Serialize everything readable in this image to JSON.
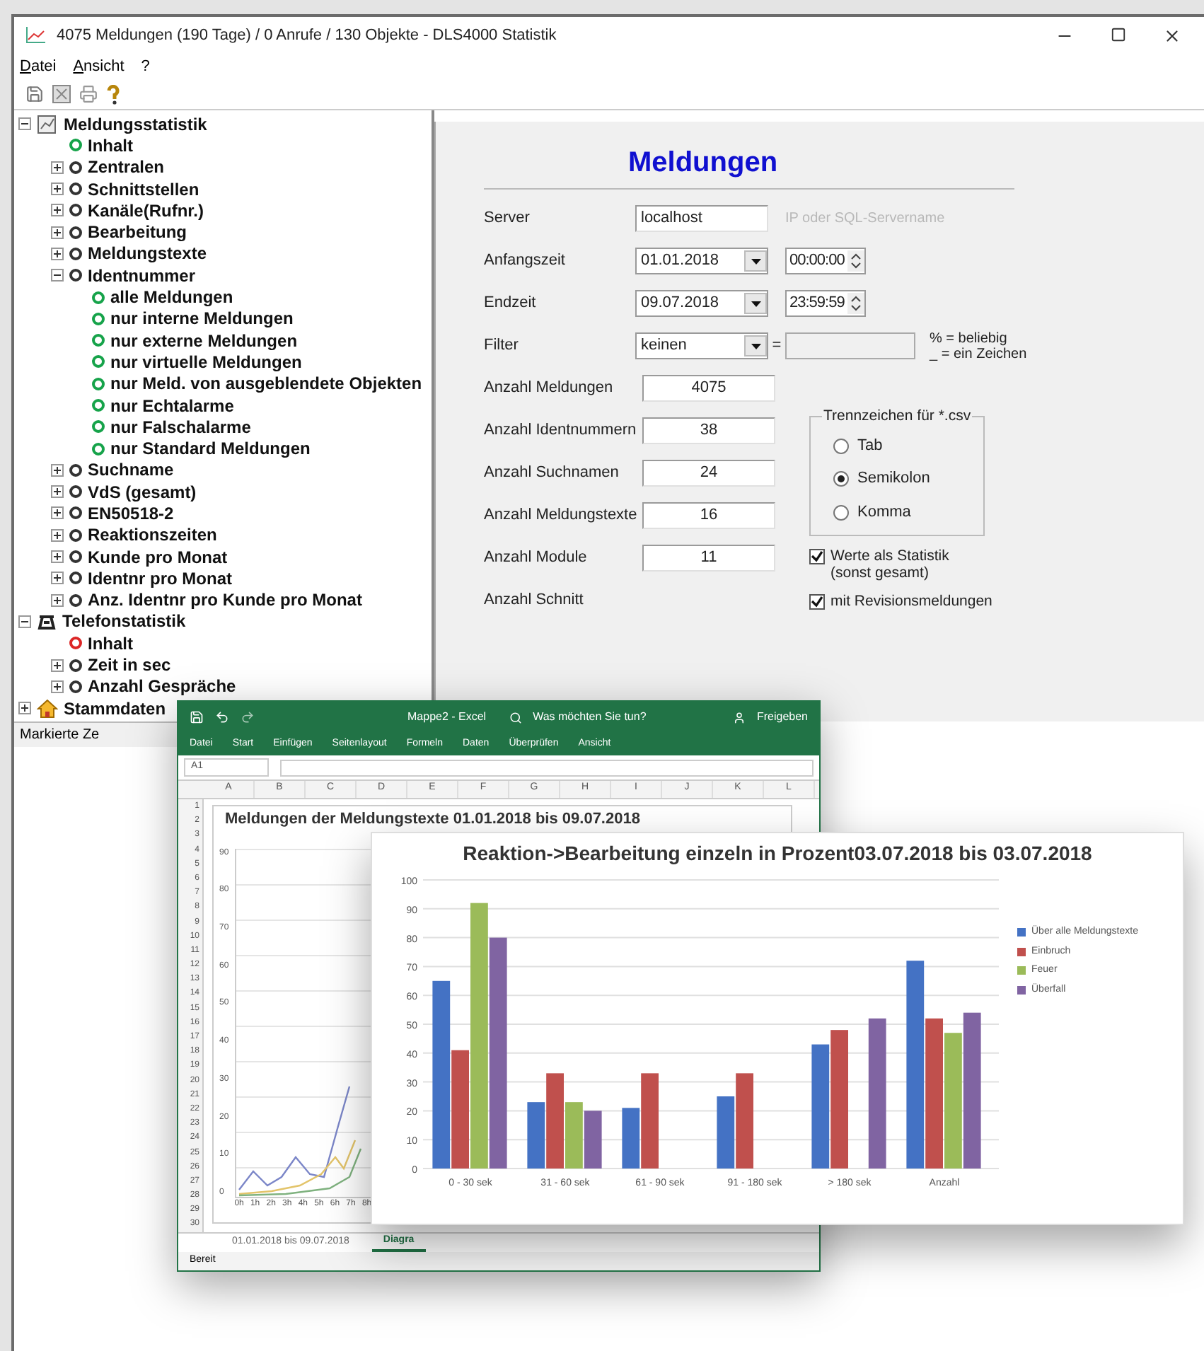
{
  "window": {
    "title": "4075 Meldungen (190 Tage) / 0 Anrufe / 130 Objekte - DLS4000 Statistik"
  },
  "menu": [
    "Datei",
    "Ansicht",
    "?"
  ],
  "tree": [
    {
      "label": "Meldungsstatistik",
      "kind": "report",
      "expanded": true,
      "children": [
        {
          "label": "Inhalt",
          "kind": "leaf",
          "color": "#16a34a"
        },
        {
          "label": "Zentralen",
          "kind": "node",
          "expanded": false,
          "color": "#333333"
        },
        {
          "label": "Schnittstellen",
          "kind": "node",
          "expanded": false,
          "color": "#333333"
        },
        {
          "label": "Kanäle(Rufnr.)",
          "kind": "node",
          "expanded": false,
          "color": "#333333"
        },
        {
          "label": "Bearbeitung",
          "kind": "node",
          "expanded": false,
          "color": "#333333"
        },
        {
          "label": "Meldungstexte",
          "kind": "node",
          "expanded": false,
          "color": "#333333"
        },
        {
          "label": "Identnummer",
          "kind": "node",
          "expanded": true,
          "color": "#333333",
          "children": [
            {
              "label": "alle Meldungen",
              "kind": "leaf",
              "color": "#16a34a"
            },
            {
              "label": "nur interne Meldungen",
              "kind": "leaf",
              "color": "#16a34a"
            },
            {
              "label": "nur externe Meldungen",
              "kind": "leaf",
              "color": "#16a34a"
            },
            {
              "label": "nur virtuelle Meldungen",
              "kind": "leaf",
              "color": "#16a34a"
            },
            {
              "label": "nur Meld. von ausgeblendete Objekten",
              "kind": "leaf",
              "color": "#16a34a"
            },
            {
              "label": "nur Echtalarme",
              "kind": "leaf",
              "color": "#16a34a"
            },
            {
              "label": "nur Falschalarme",
              "kind": "leaf",
              "color": "#16a34a"
            },
            {
              "label": "nur Standard Meldungen",
              "kind": "leaf",
              "color": "#16a34a"
            }
          ]
        },
        {
          "label": "Suchname",
          "kind": "node",
          "expanded": false,
          "color": "#333333"
        },
        {
          "label": "VdS (gesamt)",
          "kind": "node",
          "expanded": false,
          "color": "#333333"
        },
        {
          "label": "EN50518-2",
          "kind": "node",
          "expanded": false,
          "color": "#333333"
        },
        {
          "label": "Reaktionszeiten",
          "kind": "node",
          "expanded": false,
          "color": "#333333"
        },
        {
          "label": "Kunde pro Monat",
          "kind": "node",
          "expanded": false,
          "color": "#333333"
        },
        {
          "label": "Identnr pro Monat",
          "kind": "node",
          "expanded": false,
          "color": "#333333"
        },
        {
          "label": "Anz. Identnr pro Kunde pro Monat",
          "kind": "node",
          "expanded": false,
          "color": "#333333"
        }
      ]
    },
    {
      "label": "Telefonstatistik",
      "kind": "phone",
      "expanded": true,
      "children": [
        {
          "label": "Inhalt",
          "kind": "leaf",
          "color": "#dc2626"
        },
        {
          "label": "Zeit in sec",
          "kind": "node",
          "expanded": false,
          "color": "#333333"
        },
        {
          "label": "Anzahl Gespräche",
          "kind": "node",
          "expanded": false,
          "color": "#333333"
        }
      ]
    },
    {
      "label": "Stammdaten",
      "kind": "house",
      "expanded": false
    }
  ],
  "form": {
    "heading": "Meldungen",
    "server": {
      "label": "Server",
      "value": "localhost",
      "hint": "IP oder SQL-Servername"
    },
    "start": {
      "label": "Anfangszeit",
      "date": "01.01.2018",
      "time": "00:00:00"
    },
    "end": {
      "label": "Endzeit",
      "date": "09.07.2018",
      "time": "23:59:59"
    },
    "filter": {
      "label": "Filter",
      "value": "keinen",
      "equals": "=",
      "hint_lines": [
        "% = beliebig",
        "_ = ein Zeichen"
      ]
    },
    "counts": [
      {
        "label": "Anzahl Meldungen",
        "value": "4075"
      },
      {
        "label": "Anzahl Identnummern",
        "value": "38"
      },
      {
        "label": "Anzahl Suchnamen",
        "value": "24"
      },
      {
        "label": "Anzahl Meldungstexte",
        "value": "16"
      },
      {
        "label": "Anzahl Module",
        "value": "11"
      },
      {
        "label": "Anzahl Schnitt"
      }
    ],
    "separator": {
      "title": "Trennzeichen für *.csv",
      "options": [
        {
          "label": "Tab",
          "selected": false
        },
        {
          "label": "Semikolon",
          "selected": true
        },
        {
          "label": "Komma",
          "selected": false
        }
      ]
    },
    "checks": [
      {
        "label": "Werte als Statistik\n(sonst gesamt)",
        "checked": true
      },
      {
        "label": "mit Revisionsmeldungen",
        "checked": true
      }
    ]
  },
  "status_bar": "Markierte Ze",
  "excel": {
    "title": "Mappe2 - Excel",
    "search": "Was möchten Sie tun?",
    "share": "Freigeben",
    "ribbon_tabs": [
      "Datei",
      "Start",
      "Einfügen",
      "Seitenlayout",
      "Formeln",
      "Daten",
      "Überprüfen",
      "Ansicht"
    ],
    "name_box": "A1",
    "columns": [
      "A",
      "B",
      "C",
      "D",
      "E",
      "F",
      "G",
      "H",
      "I",
      "J",
      "K",
      "L"
    ],
    "rows": [
      "1",
      "2",
      "3",
      "4",
      "5",
      "6",
      "7",
      "8",
      "9",
      "10",
      "11",
      "12",
      "13",
      "14",
      "15",
      "16",
      "17",
      "18",
      "19",
      "20",
      "21",
      "22",
      "23",
      "24",
      "25",
      "26",
      "27",
      "28",
      "29",
      "30"
    ],
    "chart_title": "Meldungen der Meldungstexte 01.01.2018 bis 09.07.2018",
    "y_labels": [
      "90",
      "80",
      "70",
      "60",
      "50",
      "40",
      "30",
      "20",
      "10",
      "0"
    ],
    "x_labels": [
      "0h",
      "1h",
      "2h",
      "3h",
      "4h",
      "5h",
      "6h",
      "7h",
      "8h"
    ],
    "sheet_tabs": [
      {
        "label": "01.01.2018 bis 09.07.2018",
        "selected": false
      },
      {
        "label": "Diagra",
        "selected": true
      }
    ],
    "status": "Bereit"
  },
  "bar_chart": {
    "chart_data": {
      "type": "bar",
      "title": "Reaktion->Bearbeitung einzeln in Prozent03.07.2018 bis 03.07.2018",
      "categories": [
        "0 - 30 sek",
        "31 - 60 sek",
        "61 - 90 sek",
        "91 - 180 sek",
        "> 180 sek",
        "Anzahl"
      ],
      "yticks": [
        0,
        10,
        20,
        30,
        40,
        50,
        60,
        70,
        80,
        90,
        100
      ],
      "ylim": [
        0,
        100
      ],
      "grid": true,
      "series": [
        {
          "name": "Über alle Meldungstexte",
          "color": "#4472c4",
          "values": [
            65,
            23,
            21,
            25,
            43,
            72
          ]
        },
        {
          "name": "Einbruch",
          "color": "#c0504d",
          "values": [
            41,
            33,
            33,
            33,
            48,
            52
          ]
        },
        {
          "name": "Feuer",
          "color": "#9bbb59",
          "values": [
            92,
            23,
            null,
            null,
            null,
            47
          ]
        },
        {
          "name": "Überfall",
          "color": "#8064a2",
          "values": [
            80,
            20,
            null,
            null,
            52,
            54
          ]
        }
      ]
    }
  }
}
